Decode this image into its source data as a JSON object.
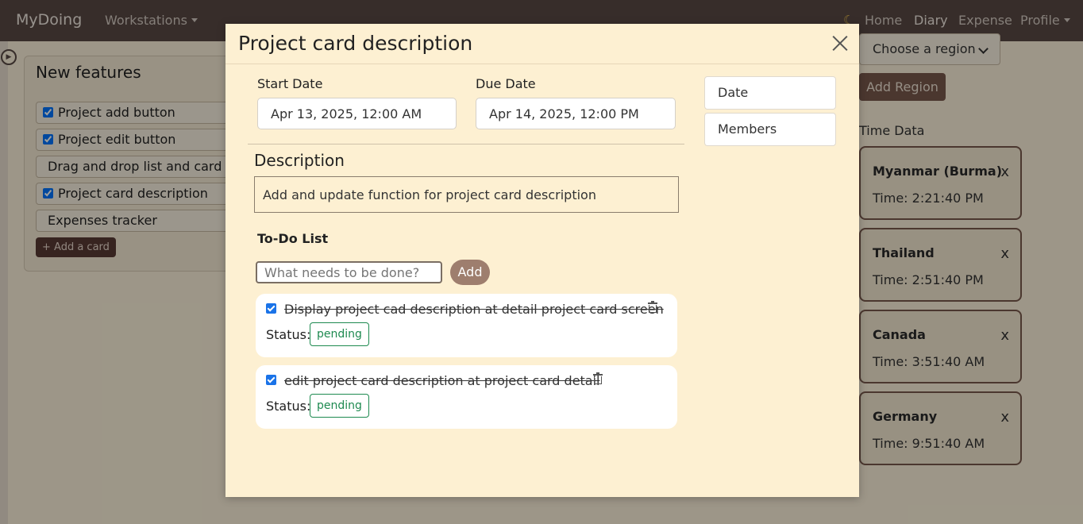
{
  "navbar": {
    "brand": "MyDoing",
    "workstations": "Workstations",
    "home": "Home",
    "diary": "Diary",
    "expense": "Expense",
    "profile": "Profile"
  },
  "background": {
    "panel_title": "New features",
    "cards": [
      {
        "label": "Project add button",
        "checked": true
      },
      {
        "label": "Project edit button",
        "checked": true
      },
      {
        "label": "Drag and drop list and card",
        "checked": false
      },
      {
        "label": "Project card description",
        "checked": true
      },
      {
        "label": "Expenses tracker",
        "checked": false
      }
    ],
    "add_card": "+ Add a card",
    "region_select": "Choose a region",
    "add_region": "Add Region",
    "time_data_title": "Time Data",
    "time_zones": [
      {
        "name": "Myanmar (Burma)",
        "time": "Time: 2:21:40 PM",
        "remove": "x"
      },
      {
        "name": "Thailand",
        "time": "Time: 2:51:40 PM",
        "remove": "x"
      },
      {
        "name": "Canada",
        "time": "Time: 3:51:40 AM",
        "remove": "x"
      },
      {
        "name": "Germany",
        "time": "Time: 9:51:40 AM",
        "remove": "x"
      }
    ]
  },
  "modal": {
    "title": "Project card description",
    "start_date_label": "Start Date",
    "start_date_value": "Apr 13, 2025, 12:00 AM",
    "due_date_label": "Due Date",
    "due_date_value": "Apr 14, 2025, 12:00 PM",
    "side_buttons": [
      "Date",
      "Members"
    ],
    "description_title": "Description",
    "description_text": "Add and update function for project card description",
    "todo_title": "To-Do List",
    "todo_placeholder": "What needs to be done?",
    "add_button": "Add",
    "status_label": "Status:",
    "todos": [
      {
        "text": "Display project cad description at detail project card screen",
        "done": true,
        "status": "pending"
      },
      {
        "text": "edit project card description at project card detail ",
        "done": true,
        "status": "pending"
      }
    ]
  }
}
